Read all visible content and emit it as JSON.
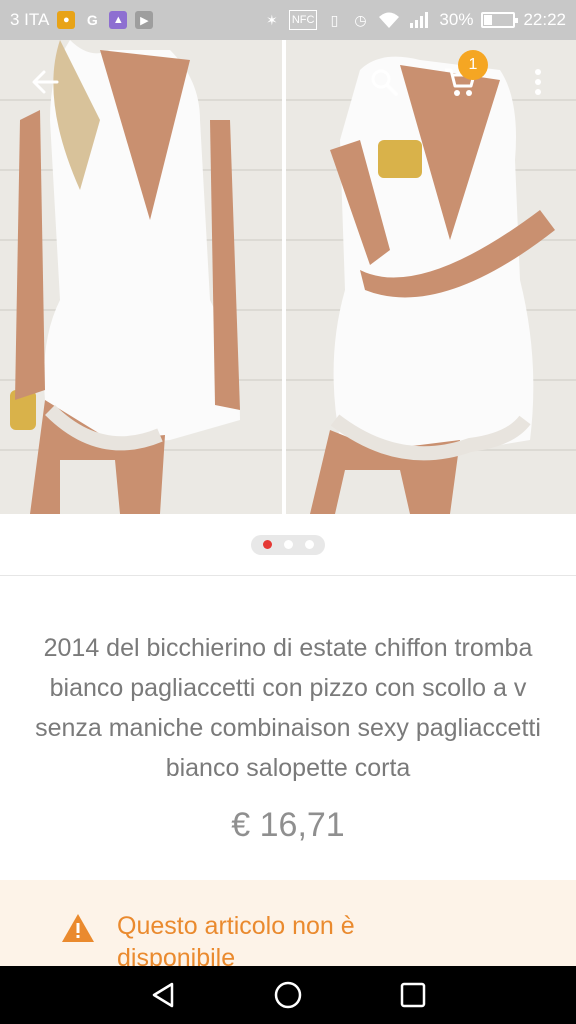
{
  "status_bar": {
    "carrier": "3 ITA",
    "nfc": "NFC",
    "battery_percent": "30%",
    "battery_level": 0.3,
    "time": "22:22"
  },
  "cart": {
    "badge_count": "1"
  },
  "pager": {
    "pages": 3,
    "active_index": 0
  },
  "product": {
    "title": "2014 del bicchierino di estate chiffon tromba bianco pagliaccetti con pizzo con scollo a v senza maniche combinaison sexy pagliaccetti bianco salopette corta",
    "price": "€ 16,71"
  },
  "notice": {
    "message": "Questo articolo non è disponibile"
  },
  "colors": {
    "accent_orange": "#f5a623",
    "warning_orange": "#ea8a2e",
    "pager_active": "#e53935"
  }
}
